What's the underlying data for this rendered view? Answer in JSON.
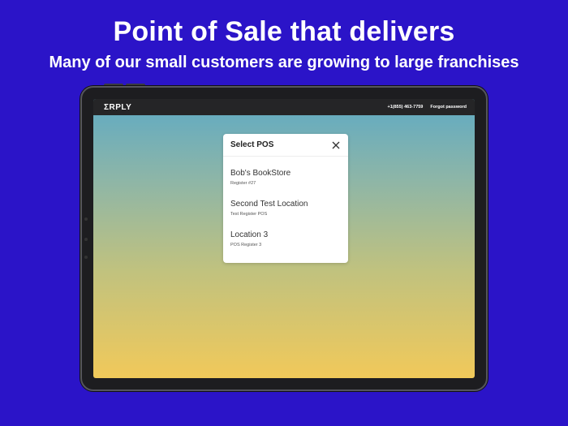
{
  "promo": {
    "headline": "Point of Sale that delivers",
    "subheadline": "Many of our small customers are growing to large franchises"
  },
  "app": {
    "logo": "ΣRPLY",
    "phone": "+1(855) 463-7759",
    "forgot_password": "Forgot password"
  },
  "dialog": {
    "title": "Select POS",
    "items": [
      {
        "name": "Bob's BookStore",
        "register": "Register #27"
      },
      {
        "name": "Second Test Location",
        "register": "Test Register POS"
      },
      {
        "name": "Location 3",
        "register": "POS Register 3"
      }
    ]
  },
  "colors": {
    "background": "#2b14c8",
    "topbar": "#252527",
    "gradient_top": "#5faac4",
    "gradient_bottom": "#f1c95a"
  },
  "icons": {
    "close": "close-icon"
  }
}
